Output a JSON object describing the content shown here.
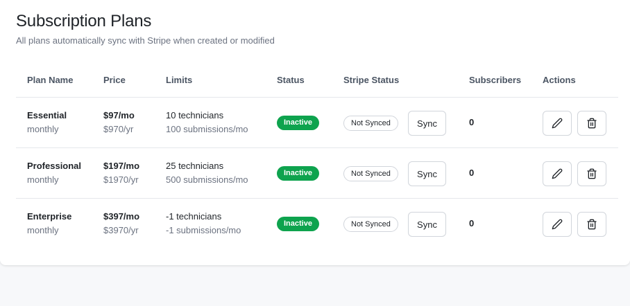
{
  "header": {
    "title": "Subscription Plans",
    "subtitle": "All plans automatically sync with Stripe when created or modified"
  },
  "table": {
    "columns": [
      "Plan Name",
      "Price",
      "Limits",
      "Status",
      "Stripe Status",
      "Subscribers",
      "Actions"
    ],
    "rows": [
      {
        "name": "Essential",
        "interval": "monthly",
        "price_monthly": "$97/mo",
        "price_yearly": "$970/yr",
        "limit_technicians": "10 technicians",
        "limit_submissions": "100 submissions/mo",
        "status": "Inactive",
        "stripe_status": "Not Synced",
        "sync_label": "Sync",
        "subscribers": "0"
      },
      {
        "name": "Professional",
        "interval": "monthly",
        "price_monthly": "$197/mo",
        "price_yearly": "$1970/yr",
        "limit_technicians": "25 technicians",
        "limit_submissions": "500 submissions/mo",
        "status": "Inactive",
        "stripe_status": "Not Synced",
        "sync_label": "Sync",
        "subscribers": "0"
      },
      {
        "name": "Enterprise",
        "interval": "monthly",
        "price_monthly": "$397/mo",
        "price_yearly": "$3970/yr",
        "limit_technicians": "-1 technicians",
        "limit_submissions": "-1 submissions/mo",
        "status": "Inactive",
        "stripe_status": "Not Synced",
        "sync_label": "Sync",
        "subscribers": "0"
      }
    ]
  },
  "icons": {
    "edit": "pencil-icon",
    "delete": "trash-icon"
  },
  "colors": {
    "status_inactive_bg": "#0ea34e",
    "border": "#d1d5db",
    "muted_text": "#6b7280"
  }
}
